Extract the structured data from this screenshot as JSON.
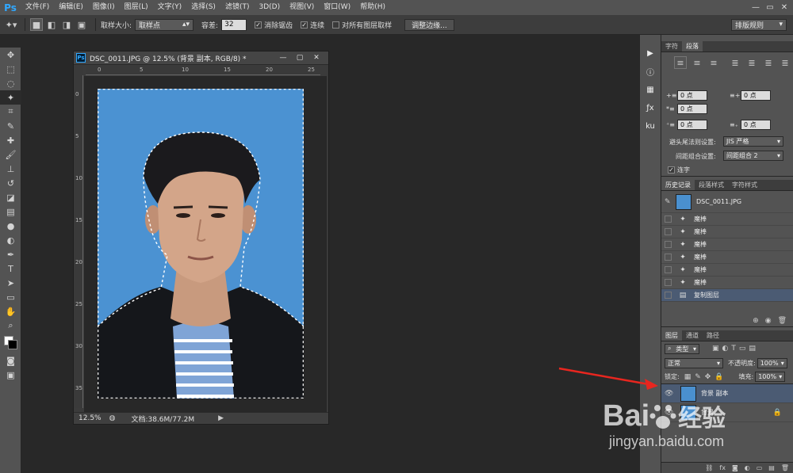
{
  "app": {
    "logo": "Ps"
  },
  "menu": [
    "文件(F)",
    "编辑(E)",
    "图像(I)",
    "图层(L)",
    "文字(Y)",
    "选择(S)",
    "滤镜(T)",
    "3D(D)",
    "视图(V)",
    "窗口(W)",
    "帮助(H)"
  ],
  "window_controls": {
    "minimize": "—",
    "restore": "▭",
    "close": "✕"
  },
  "options": {
    "sample_size_label": "取样大小:",
    "sample_size_value": "取样点",
    "tolerance_label": "容差:",
    "tolerance_value": "32",
    "antialias_label": "消除锯齿",
    "contiguous_label": "连续",
    "all_layers_label": "对所有图层取样",
    "refine_edge_label": "调整边缘...",
    "workspace_value": "排版规则"
  },
  "document": {
    "title": "DSC_0011.JPG @ 12.5% (背景 副本, RGB/8) *",
    "ps_badge": "Ps",
    "controls": {
      "min": "—",
      "max": "▢",
      "close": "✕"
    },
    "ruler_top": [
      "0",
      "5",
      "10",
      "15",
      "20",
      "25"
    ],
    "ruler_left": [
      "0",
      "5",
      "10",
      "15",
      "20",
      "25",
      "30",
      "35"
    ],
    "zoom": "12.5%",
    "doc_info": "文档:38.6M/77.2M"
  },
  "panel_char": {
    "tabs": [
      "字符",
      "段落"
    ],
    "fields": {
      "indent_left": "0 点",
      "indent_right": "0 点",
      "indent_first": "0 点",
      "space_before": "0 点",
      "space_after": "0 点"
    },
    "kinsoku_label": "避头尾法则设置:",
    "kinsoku_value": "JIS 严格",
    "mojikumi_label": "间距组合设置:",
    "mojikumi_value": "间距组合 2",
    "hyphenate_label": "连字"
  },
  "panel_history": {
    "tabs": [
      "历史记录",
      "段落样式",
      "字符样式"
    ],
    "snapshot": "DSC_0011.JPG",
    "items": [
      "魔棒",
      "魔棒",
      "魔棒",
      "魔棒",
      "魔棒",
      "魔棒",
      "复制图层"
    ]
  },
  "panel_layers": {
    "tabs": [
      "图层",
      "通道",
      "路径"
    ],
    "filter_value": "类型",
    "blend_mode": "正常",
    "opacity_label": "不透明度:",
    "opacity_value": "100%",
    "lock_label": "锁定:",
    "fill_label": "填充:",
    "fill_value": "100%",
    "layers": [
      {
        "name": "背景 副本",
        "selected": true
      },
      {
        "name": "背景",
        "selected": false
      }
    ]
  },
  "watermark": {
    "brand": "Bai",
    "brand2": "经验",
    "url": "jingyan.baidu.com"
  },
  "colors": {
    "accent": "#31a8ff",
    "selection": "#4b5b73",
    "arrow": "#e8261f",
    "photo_bg": "#4a90cf"
  }
}
